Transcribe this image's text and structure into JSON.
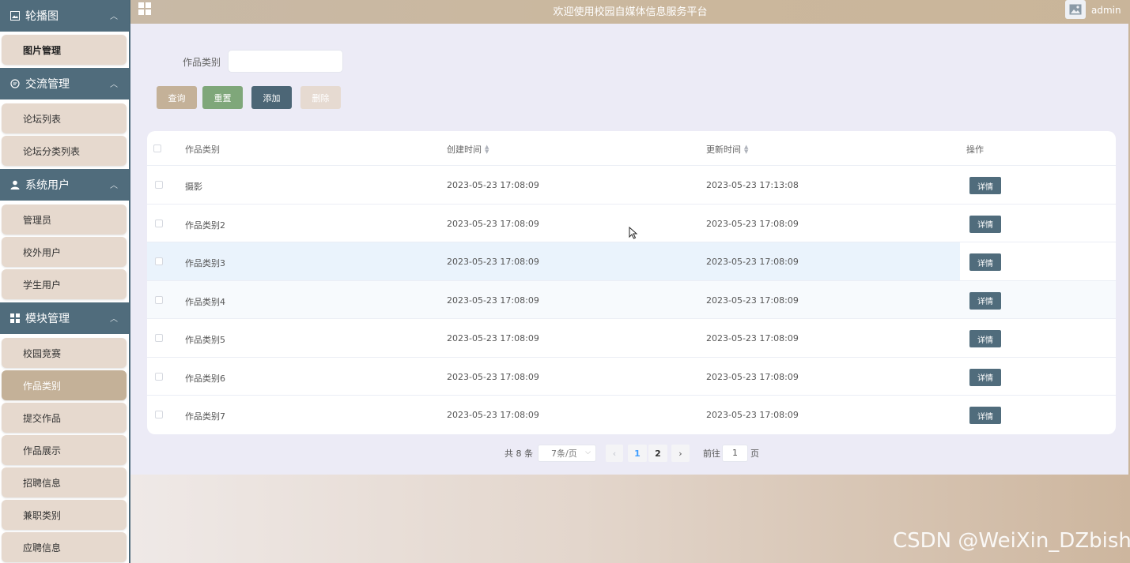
{
  "header": {
    "title": "欢迎使用校园自媒体信息服务平台",
    "username": "admin"
  },
  "sidebar": {
    "groups": [
      {
        "label": "轮播图",
        "icon": "image-icon",
        "items": [
          "图片管理"
        ]
      },
      {
        "label": "交流管理",
        "icon": "chat-icon",
        "items": [
          "论坛列表",
          "论坛分类列表"
        ]
      },
      {
        "label": "系统用户",
        "icon": "user-icon",
        "items": [
          "管理员",
          "校外用户",
          "学生用户"
        ]
      },
      {
        "label": "模块管理",
        "icon": "grid-icon",
        "items": [
          "校园竞赛",
          "作品类别",
          "提交作品",
          "作品展示",
          "招聘信息",
          "兼职类别",
          "应聘信息"
        ]
      }
    ],
    "active_item": "作品类别"
  },
  "search": {
    "label": "作品类别",
    "value": ""
  },
  "buttons": {
    "query": "查询",
    "reset": "重置",
    "add": "添加",
    "delete": "删除"
  },
  "table": {
    "columns": [
      "作品类别",
      "创建时间",
      "更新时间",
      "操作"
    ],
    "rows": [
      {
        "category": "摄影",
        "created": "2023-05-23 17:08:09",
        "updated": "2023-05-23 17:13:08",
        "action": "详情"
      },
      {
        "category": "作品类别2",
        "created": "2023-05-23 17:08:09",
        "updated": "2023-05-23 17:08:09",
        "action": "详情"
      },
      {
        "category": "作品类别3",
        "created": "2023-05-23 17:08:09",
        "updated": "2023-05-23 17:08:09",
        "action": "详情"
      },
      {
        "category": "作品类别4",
        "created": "2023-05-23 17:08:09",
        "updated": "2023-05-23 17:08:09",
        "action": "详情"
      },
      {
        "category": "作品类别5",
        "created": "2023-05-23 17:08:09",
        "updated": "2023-05-23 17:08:09",
        "action": "详情"
      },
      {
        "category": "作品类别6",
        "created": "2023-05-23 17:08:09",
        "updated": "2023-05-23 17:08:09",
        "action": "详情"
      },
      {
        "category": "作品类别7",
        "created": "2023-05-23 17:08:09",
        "updated": "2023-05-23 17:08:09",
        "action": "详情"
      }
    ]
  },
  "pagination": {
    "total": "共 8 条",
    "page_size": "7条/页",
    "pages": [
      "1",
      "2"
    ],
    "current_page": "1",
    "goto_label": "前往",
    "goto_value": "1",
    "page_suffix": "页"
  },
  "watermark": "CSDN @WeiXin_DZbishe",
  "colors": {
    "sidebar_header": "#506c7c",
    "menu_item": "#e6d9ce",
    "menu_active": "#c4b198",
    "topbar": "#cbb79c",
    "reset_button": "#7fa77a",
    "add_button": "#4c6676",
    "detail_button": "#506c7c",
    "main_bg": "#ecebf6"
  }
}
